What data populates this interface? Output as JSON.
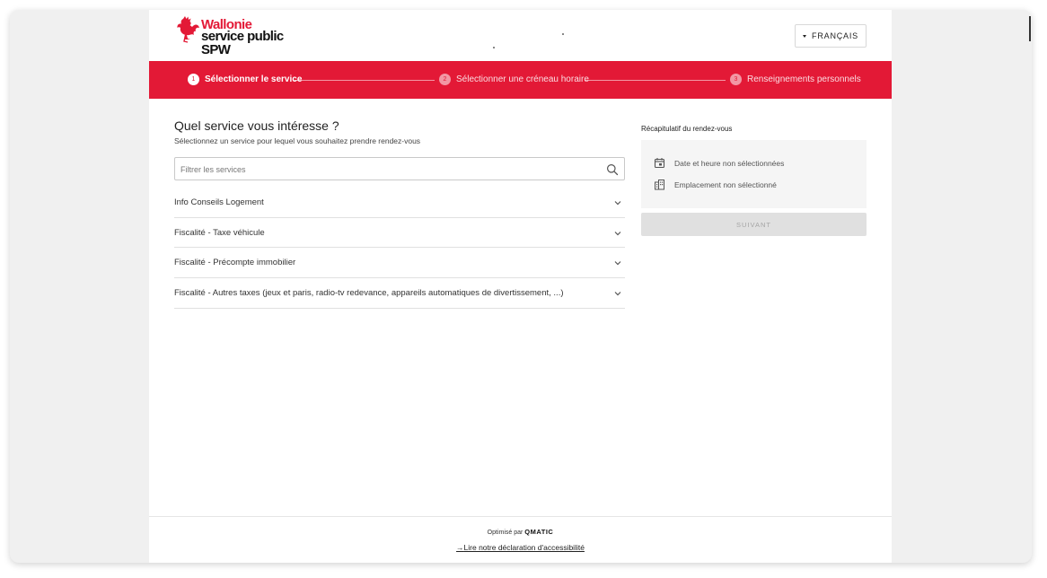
{
  "header": {
    "logo": {
      "line1": "Wallonie",
      "line2": "service public",
      "line3": "SPW"
    },
    "language_button": "FRANÇAIS"
  },
  "stepper": {
    "steps": [
      {
        "number": "1",
        "label": "Sélectionner le service",
        "active": true
      },
      {
        "number": "2",
        "label": "Sélectionner une créneau horaire",
        "active": false
      },
      {
        "number": "3",
        "label": "Renseignements personnels",
        "active": false
      }
    ]
  },
  "main": {
    "title": "Quel service vous intéresse ?",
    "subtitle": "Sélectionnez un service pour lequel vous souhaitez prendre rendez-vous",
    "filter_placeholder": "Filtrer les services",
    "services": [
      {
        "label": "Info Conseils Logement"
      },
      {
        "label": "Fiscalité - Taxe véhicule"
      },
      {
        "label": "Fiscalité - Précompte immobilier"
      },
      {
        "label": "Fiscalité - Autres taxes (jeux et paris, radio-tv redevance, appareils automatiques de divertissement, ...)"
      }
    ]
  },
  "summary": {
    "title": "Récapitulatif du rendez-vous",
    "date_status": "Date et heure non sélectionnées",
    "location_status": "Emplacement non sélectionné",
    "next_button": "SUIVANT"
  },
  "footer": {
    "powered_prefix": "Optimisé par",
    "powered_brand": "QMATIC",
    "accessibility_link": "Lire notre déclaration d'accessibilité"
  },
  "colors": {
    "brand_red": "#e31936",
    "disabled_button": "#e0e0e0"
  },
  "icons": [
    "rooster-logo-icon",
    "caret-down-icon",
    "search-icon",
    "chevron-down-icon",
    "calendar-icon",
    "building-icon",
    "arrow-right-icon"
  ]
}
